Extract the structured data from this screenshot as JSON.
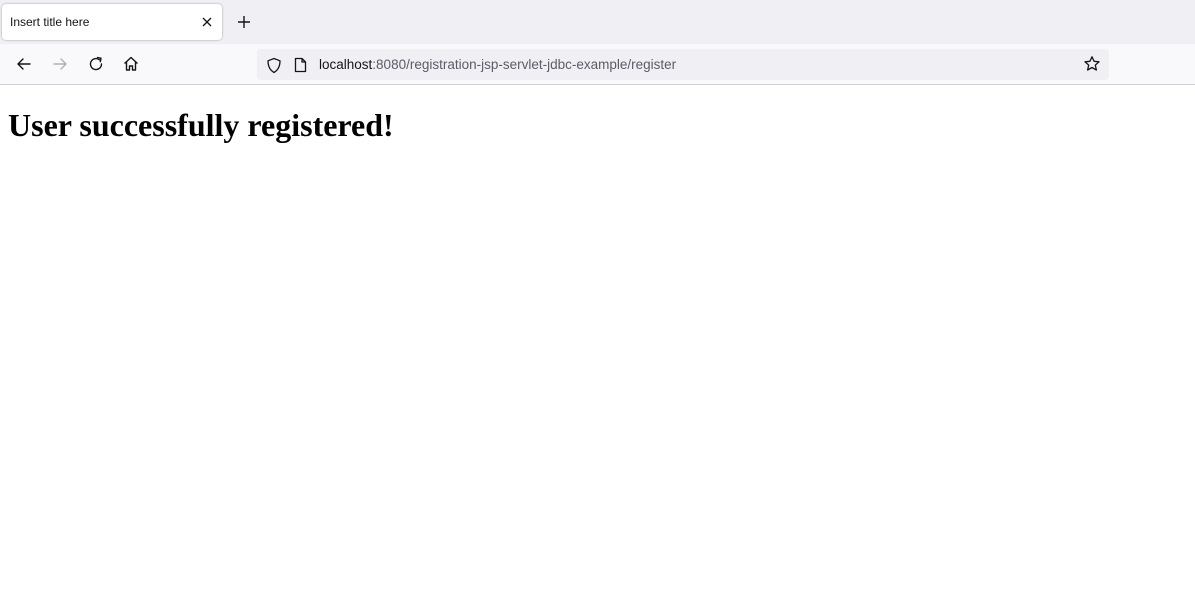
{
  "tab": {
    "title": "Insert title here"
  },
  "icons": {
    "close": "close-icon",
    "new_tab": "plus-icon",
    "back": "arrow-left-icon",
    "forward": "arrow-right-icon",
    "reload": "reload-icon",
    "home": "home-icon",
    "shield": "shield-icon",
    "page": "page-icon",
    "bookmark": "star-icon"
  },
  "address": {
    "host": "localhost",
    "rest": ":8080/registration-jsp-servlet-jdbc-example/register"
  },
  "page": {
    "heading": "User successfully registered!"
  },
  "colors": {
    "tabstrip": "#f0f0f4",
    "toolbar": "#f9f9fb",
    "forward_disabled": "#b0b0b8"
  }
}
